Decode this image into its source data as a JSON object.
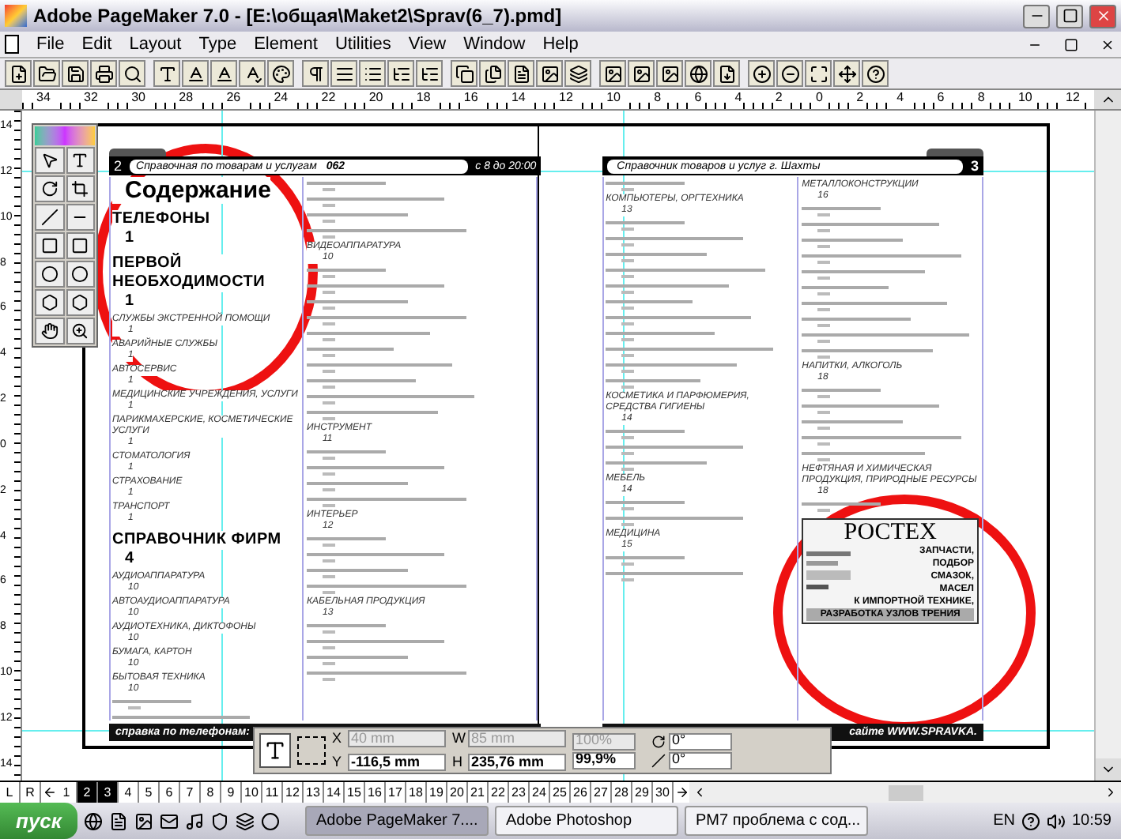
{
  "window": {
    "title": "Adobe PageMaker 7.0 - [E:\\общая\\Maket2\\Sprav(6_7).pmd]"
  },
  "menu": [
    "File",
    "Edit",
    "Layout",
    "Type",
    "Element",
    "Utilities",
    "View",
    "Window",
    "Help"
  ],
  "ruler": {
    "horizontal": [
      "34",
      "32",
      "30",
      "28",
      "26",
      "24",
      "22",
      "20",
      "18",
      "16",
      "14",
      "12",
      "10",
      "8",
      "6",
      "4",
      "2",
      "0",
      "2",
      "4",
      "6",
      "8",
      "10",
      "12"
    ],
    "vertical": [
      "14",
      "12",
      "10",
      "8",
      "6",
      "4",
      "2",
      "0",
      "2",
      "4",
      "6",
      "8",
      "10",
      "12",
      "14"
    ]
  },
  "left_page": {
    "number": "2",
    "header": "Справочная по товарам и услугам",
    "code": "062",
    "hours": "с 8 до 20:00",
    "contents_title": "Содержание",
    "column_1": [
      {
        "kind": "heading",
        "text": "ТЕЛЕФОНЫ",
        "page": "1"
      },
      {
        "kind": "heading",
        "text": "ПЕРВОЙ НЕОБХОДИМОСТИ",
        "page": "1"
      },
      {
        "kind": "entry",
        "text": "СЛУЖБЫ ЭКСТРЕННОЙ ПОМОЩИ",
        "page": "1"
      },
      {
        "kind": "entry",
        "text": "АВАРИЙНЫЕ СЛУЖБЫ",
        "page": "1"
      },
      {
        "kind": "entry",
        "text": "АВТОСЕРВИС",
        "page": "1"
      },
      {
        "kind": "entry",
        "text": "МЕДИЦИНСКИЕ УЧРЕЖДЕНИЯ, УСЛУГИ",
        "page": "1"
      },
      {
        "kind": "entry",
        "text": "ПАРИКМАХЕРСКИЕ, КОСМЕТИЧЕСКИЕ УСЛУГИ",
        "page": "1"
      },
      {
        "kind": "entry",
        "text": "СТОМАТОЛОГИЯ",
        "page": "1"
      },
      {
        "kind": "entry",
        "text": "СТРАХОВАНИЕ",
        "page": "1"
      },
      {
        "kind": "entry",
        "text": "ТРАНСПОРТ",
        "page": "1"
      },
      {
        "kind": "heading",
        "text": "СПРАВОЧНИК ФИРМ",
        "page": "4"
      },
      {
        "kind": "entry",
        "text": "АУДИОАППАРАТУРА",
        "page": "10"
      },
      {
        "kind": "entry",
        "text": "АВТОАУДИОАППАРАТУРА",
        "page": "10"
      },
      {
        "kind": "entry",
        "text": "АУДИОТЕХНИКА, ДИКТОФОНЫ",
        "page": "10"
      },
      {
        "kind": "entry",
        "text": "БУМАГА, КАРТОН",
        "page": "10"
      },
      {
        "kind": "entry",
        "text": "БЫТОВАЯ ТЕХНИКА",
        "page": "10"
      }
    ],
    "column_2": [
      {
        "kind": "entry",
        "text": "ВИДЕОАППАРАТУРА",
        "page": "10"
      },
      {
        "kind": "entry",
        "text": "ИНСТРУМЕНТ",
        "page": "11"
      },
      {
        "kind": "entry",
        "text": "ИНТЕРЬЕР",
        "page": "12"
      },
      {
        "kind": "entry",
        "text": "КАБЕЛЬНАЯ ПРОДУКЦИЯ",
        "page": "13"
      }
    ],
    "footer": "справка по телефонам:"
  },
  "right_page": {
    "number": "3",
    "header": "Справочник товаров и услуг г. Шахты",
    "column_1": [
      {
        "kind": "entry",
        "text": "КОМПЬЮТЕРЫ, ОРГТЕХНИКА",
        "page": "13"
      },
      {
        "kind": "entry",
        "text": "КОСМЕТИКА И ПАРФЮМЕРИЯ, СРЕДСТВА ГИГИЕНЫ",
        "page": "14"
      },
      {
        "kind": "entry",
        "text": "МЕБЕЛЬ",
        "page": "14"
      },
      {
        "kind": "entry",
        "text": "МЕДИЦИНА",
        "page": "15"
      }
    ],
    "column_2": [
      {
        "kind": "entry",
        "text": "МЕТАЛЛОКОНСТРУКЦИИ",
        "page": "16"
      },
      {
        "kind": "entry",
        "text": "НАПИТКИ, АЛКОГОЛЬ",
        "page": "18"
      },
      {
        "kind": "entry",
        "text": "НЕФТЯНАЯ И ХИМИЧЕСКАЯ ПРОДУКЦИЯ, ПРИРОДНЫЕ РЕСУРСЫ",
        "page": "18"
      }
    ],
    "ad": {
      "brand": "РОСТЕХ",
      "lines": [
        "ЗАПЧАСТИ,",
        "ПОДБОР",
        "СМАЗОК,",
        "МАСЕЛ",
        "К ИМПОРТНОЙ ТЕХНИКЕ,"
      ],
      "banner": "РАЗРАБОТКА УЗЛОВ ТРЕНИЯ"
    },
    "footer": "сайте WWW.SPRAVKA."
  },
  "control_palette": {
    "x_label": "X",
    "x": "40 mm",
    "y_label": "Y",
    "y": "-116,5 mm",
    "w_label": "W",
    "w": "85 mm",
    "h_label": "H",
    "h": "235,76 mm",
    "scale_w": "100%",
    "scale_h": "99,9%",
    "rotation": "0°",
    "skew": "0°"
  },
  "page_tabs": [
    {
      "label": "L",
      "selected": false
    },
    {
      "label": "R",
      "selected": false
    },
    {
      "label": "1",
      "selected": false
    },
    {
      "label": "2",
      "selected": true
    },
    {
      "label": "3",
      "selected": true
    },
    {
      "label": "4",
      "selected": false
    },
    {
      "label": "5",
      "selected": false
    },
    {
      "label": "6",
      "selected": false
    },
    {
      "label": "7",
      "selected": false
    },
    {
      "label": "8",
      "selected": false
    },
    {
      "label": "9",
      "selected": false
    },
    {
      "label": "10",
      "selected": false
    },
    {
      "label": "11",
      "selected": false
    },
    {
      "label": "12",
      "selected": false
    },
    {
      "label": "13",
      "selected": false
    },
    {
      "label": "14",
      "selected": false
    },
    {
      "label": "15",
      "selected": false
    },
    {
      "label": "16",
      "selected": false
    },
    {
      "label": "17",
      "selected": false
    },
    {
      "label": "18",
      "selected": false
    },
    {
      "label": "19",
      "selected": false
    },
    {
      "label": "20",
      "selected": false
    },
    {
      "label": "21",
      "selected": false
    },
    {
      "label": "22",
      "selected": false
    },
    {
      "label": "23",
      "selected": false
    },
    {
      "label": "24",
      "selected": false
    },
    {
      "label": "25",
      "selected": false
    },
    {
      "label": "26",
      "selected": false
    },
    {
      "label": "27",
      "selected": false
    },
    {
      "label": "28",
      "selected": false
    },
    {
      "label": "29",
      "selected": false
    },
    {
      "label": "30",
      "selected": false
    }
  ],
  "taskbar": {
    "start": "пуск",
    "tasks": [
      {
        "label": "Adobe PageMaker 7....",
        "selected": true
      },
      {
        "label": "Adobe Photoshop",
        "selected": false
      },
      {
        "label": "PM7 проблема с сод...",
        "selected": false
      }
    ],
    "language": "EN",
    "clock": "10:59"
  }
}
